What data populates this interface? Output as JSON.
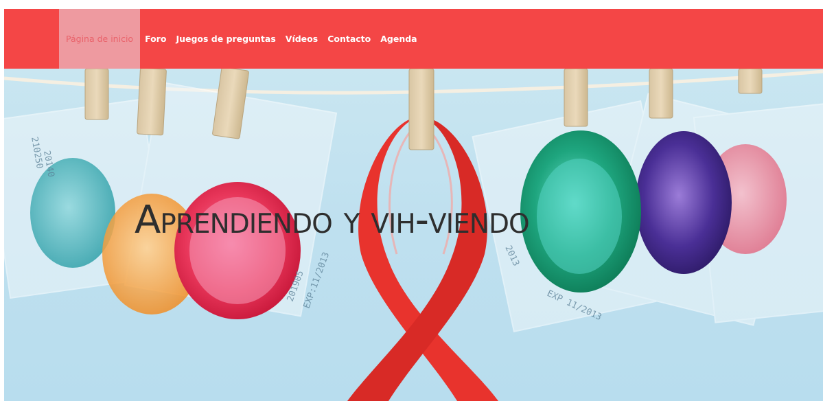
{
  "nav": {
    "items": [
      {
        "label": "Página de inicio",
        "active": true
      },
      {
        "label": "Foro"
      },
      {
        "label": "Juegos de preguntas"
      },
      {
        "label": "Vídeos"
      },
      {
        "label": "Contacto"
      },
      {
        "label": "Agenda"
      }
    ],
    "background_color": "#f44646",
    "active_color": "#ee9aa0"
  },
  "hero": {
    "title": "Aprendiendo y vih-viendo",
    "packet_text": {
      "left_top": "210250",
      "left_top_sub": "20140",
      "red_exp": "EXP:11/2013",
      "red_lot": "201905",
      "green_exp": "2013",
      "right_exp": "EXP 11/2013"
    }
  }
}
